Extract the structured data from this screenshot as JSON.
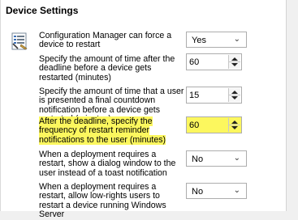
{
  "section": {
    "title": "Device Settings"
  },
  "settings": [
    {
      "label": "Configuration Manager can force a device to restart",
      "control": "dropdown",
      "value": "Yes"
    },
    {
      "label": "Specify the amount of time after the deadline before a device gets restarted (minutes)",
      "control": "spin",
      "value": "60"
    },
    {
      "label": "Specify the amount of time that a user is presented a final countdown notification before a device gets restarted (minutes)",
      "control": "spin",
      "value": "15"
    },
    {
      "label": "After the deadline, specify the frequency of restart reminder notifications to the user (minutes)",
      "control": "spin",
      "value": "60",
      "highlighted": true
    },
    {
      "label": "When a deployment requires a restart, show a dialog window to the user instead of a toast notification",
      "control": "dropdown",
      "value": "No"
    },
    {
      "label": "When a deployment requires a restart, allow low-rights users to restart a device running Windows Server",
      "control": "dropdown",
      "value": "No"
    }
  ],
  "icons": {
    "settings_icon": "settings-list-icon",
    "chevron": "chevron-down-icon",
    "spin_up": "spin-up-icon",
    "spin_down": "spin-down-icon"
  },
  "colors": {
    "highlight": "#fcf75e",
    "border": "#adadad"
  }
}
